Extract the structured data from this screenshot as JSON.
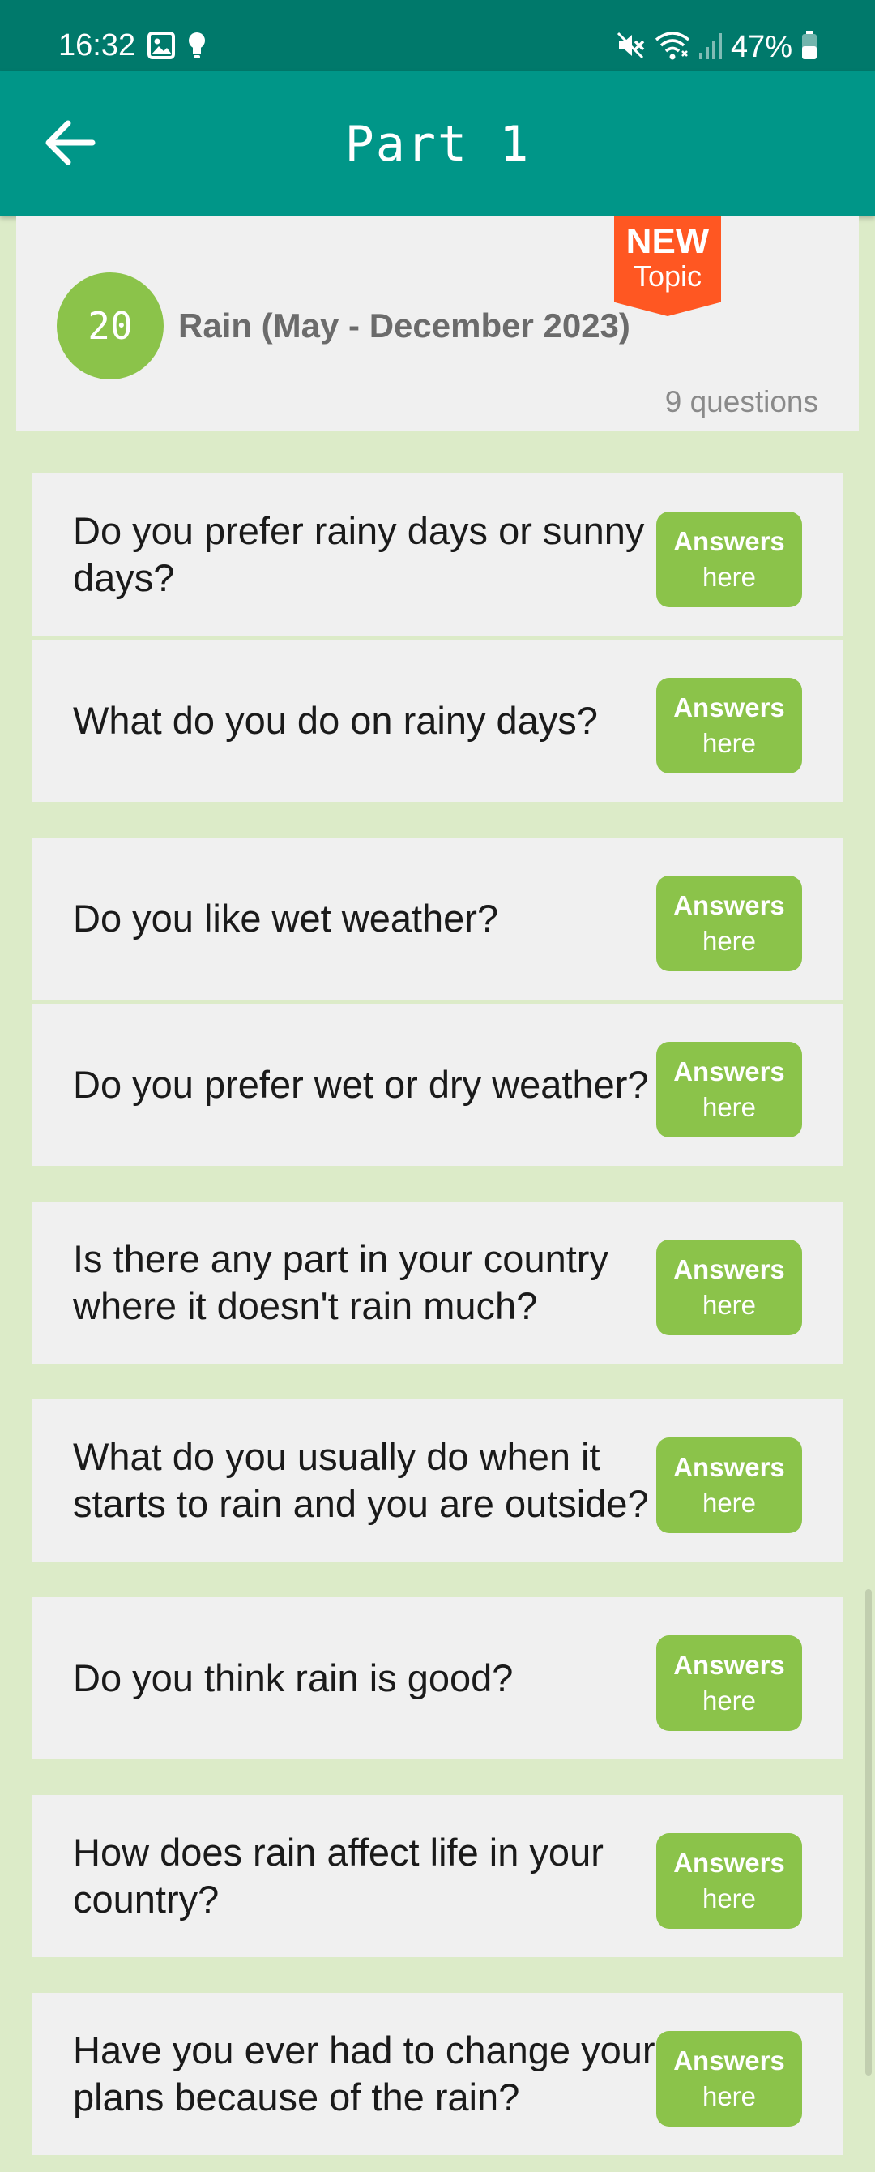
{
  "status_bar": {
    "time": "16:32",
    "battery": "47%",
    "icons": [
      "gallery-icon",
      "bulb-icon",
      "mute-icon",
      "wifi-icon",
      "signal-icon",
      "battery-icon"
    ]
  },
  "app_bar": {
    "title": "Part 1",
    "back_icon": "arrow-left-icon"
  },
  "topic": {
    "number": "20",
    "title": "Rain (May - December 2023)",
    "count": "9 questions",
    "badge_new": "NEW",
    "badge_topic": "Topic"
  },
  "questions": [
    {
      "text": "Do you prefer rainy days or sunny days?",
      "button_top": "Answers",
      "button_bottom": "here"
    },
    {
      "text": "What do you do on rainy days?",
      "button_top": "Answers",
      "button_bottom": "here"
    },
    {
      "text": "Do you like wet weather?",
      "button_top": "Answers",
      "button_bottom": "here"
    },
    {
      "text": "Do you prefer wet or dry weather?",
      "button_top": "Answers",
      "button_bottom": "here"
    },
    {
      "text": "Is there any part in your country where it doesn't rain much?",
      "button_top": "Answers",
      "button_bottom": "here"
    },
    {
      "text": "What do you usually do when it starts to rain and you are outside?",
      "button_top": "Answers",
      "button_bottom": "here"
    },
    {
      "text": "Do you think rain is good?",
      "button_top": "Answers",
      "button_bottom": "here"
    },
    {
      "text": "How does rain affect life in your country?",
      "button_top": "Answers",
      "button_bottom": "here"
    },
    {
      "text": "Have you ever had to change your plans because of the rain?",
      "button_top": "Answers",
      "button_bottom": "here"
    }
  ],
  "colors": {
    "status_bar": "#00796b",
    "app_bar": "#009688",
    "background": "#dcebc8",
    "accent_green": "#8bc34a",
    "badge_orange": "#ff5722"
  }
}
